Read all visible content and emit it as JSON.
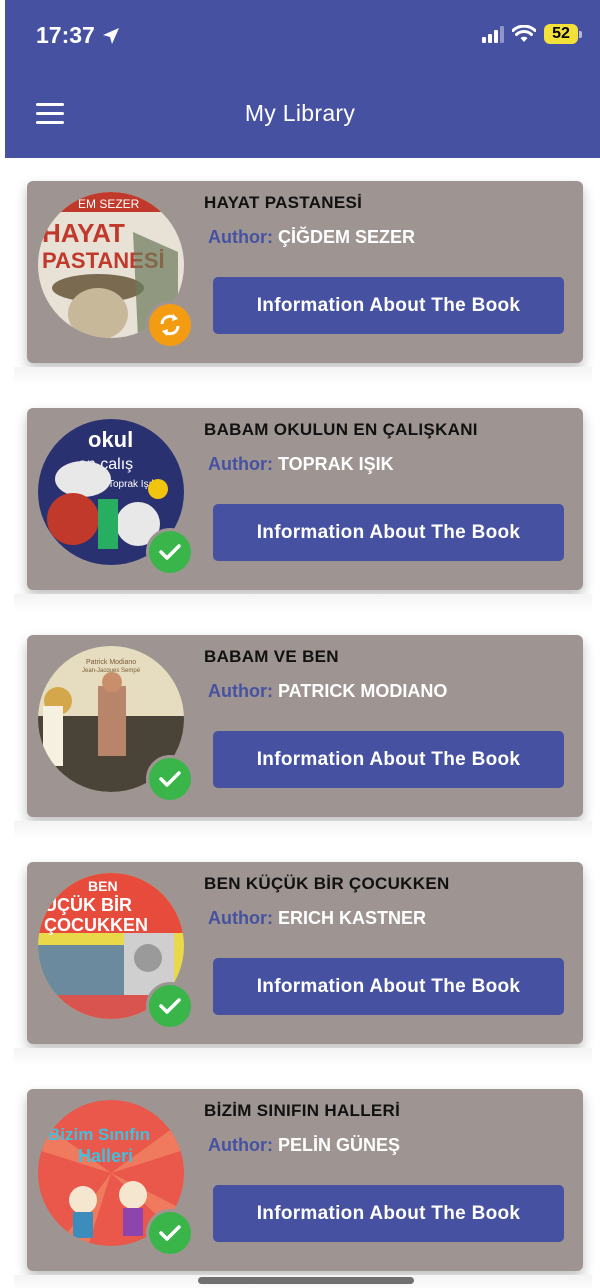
{
  "status_bar": {
    "time": "17:37",
    "battery": "52"
  },
  "app_bar": {
    "title": "My Library"
  },
  "books": [
    {
      "title": "HAYAT PASTANESİ",
      "author_label": "Author:",
      "author": "ÇİĞDEM SEZER",
      "button_label": "Information About The Book",
      "cover_text_1": "HAYAT",
      "cover_text_2": "PASTANESİ",
      "cover_text_3": "EM SEZER",
      "status": "sync"
    },
    {
      "title": "BABAM OKULUN EN ÇALIŞKANI",
      "author_label": "Author:",
      "author": "TOPRAK IŞIK",
      "button_label": "Information About The Book",
      "cover_text_1": "okul",
      "cover_text_2": "en çalış",
      "cover_text_3": "Toprak Işık",
      "status": "done"
    },
    {
      "title": "BABAM VE BEN",
      "author_label": "Author:",
      "author": "PATRICK MODIANO",
      "button_label": "Information About The Book",
      "cover_text_1": "Patrick Modiano",
      "cover_text_2": "Jean-Jacques Sempé",
      "cover_text_3": "",
      "status": "done"
    },
    {
      "title": "BEN KÜÇÜK BİR ÇOCUKKEN",
      "author_label": "Author:",
      "author": "ERICH KASTNER",
      "button_label": "Information About The Book",
      "cover_text_1": "BEN",
      "cover_text_2": "ÜÇÜK BİR",
      "cover_text_3": "ÇOCUKKEN",
      "status": "done"
    },
    {
      "title": "BİZİM SINIFIN HALLERİ",
      "author_label": "Author:",
      "author": "PELİN GÜNEŞ",
      "button_label": "Information About The Book",
      "cover_text_1": "Bizim Sınıfın",
      "cover_text_2": "Halleri",
      "cover_text_3": "",
      "status": "done"
    }
  ],
  "icons": {
    "menu": "hamburger-menu-icon",
    "location": "location-arrow-icon",
    "signal": "cellular-signal-icon",
    "wifi": "wifi-icon",
    "battery": "battery-icon",
    "sync": "sync-icon",
    "done": "checkmark-icon"
  },
  "colors": {
    "primary": "#4652a1",
    "card": "#9e9592",
    "sync_badge": "#f39c12",
    "done_badge": "#39b54a"
  }
}
